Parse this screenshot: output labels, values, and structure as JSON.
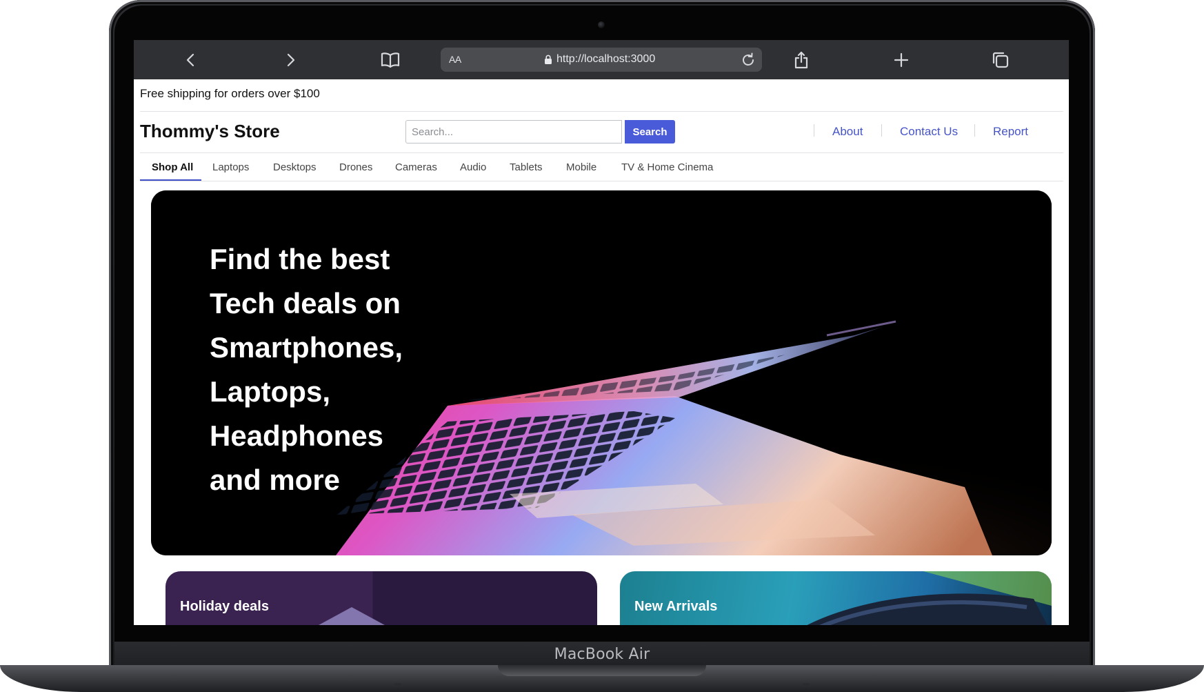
{
  "device": {
    "label": "MacBook Air"
  },
  "browser": {
    "reader_label": "AA",
    "url": "http://localhost:3000",
    "icons": [
      "back-icon",
      "forward-icon",
      "bookmarks-icon",
      "lock-icon",
      "reload-icon",
      "share-icon",
      "new-tab-icon",
      "tabs-icon"
    ]
  },
  "page": {
    "announcement": "Free shipping for orders over $100",
    "brand": "Thommy's Store",
    "search": {
      "placeholder": "Search...",
      "button_label": "Search"
    },
    "top_links": [
      "About",
      "Contact Us",
      "Report"
    ],
    "categories": {
      "items": [
        "Shop All",
        "Laptops",
        "Desktops",
        "Drones",
        "Cameras",
        "Audio",
        "Tablets",
        "Mobile",
        "TV & Home Cinema"
      ],
      "active": "Shop All"
    },
    "hero": {
      "headline": "Find the best Tech deals on Smartphones, Laptops, Headphones and more"
    },
    "promos": [
      "Holiday deals",
      "New Arrivals"
    ]
  },
  "colors": {
    "accent": "#4a5bd9",
    "link": "#4654c8",
    "toolbar": "#2f3033",
    "hero_bg": "#000000"
  }
}
